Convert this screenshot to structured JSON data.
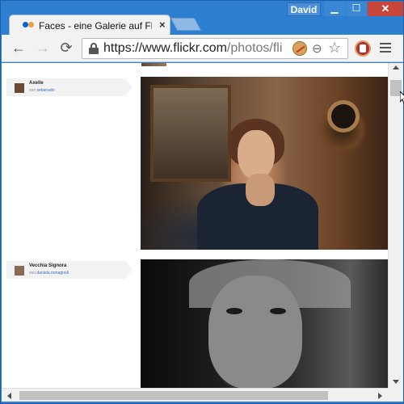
{
  "window": {
    "profile_name": "David",
    "min_glyph": "▁",
    "max_glyph": "☐",
    "close_glyph": "✕"
  },
  "tab": {
    "title": "Faces - eine Galerie auf Fli",
    "close_glyph": "×"
  },
  "toolbar": {
    "back_glyph": "←",
    "forward_glyph": "→",
    "reload_glyph": "⟳",
    "url_host": "https://www.flickr.com",
    "url_path": "/photos/fli",
    "zoom_glyph": "⊖",
    "star_glyph": "☆"
  },
  "gallery": {
    "items": [
      {
        "title": "Axelle",
        "by_prefix": "von",
        "author": "sebanado"
      },
      {
        "title": "Vecchia Signora",
        "by_prefix": "von",
        "author": "daniela romagnoli"
      }
    ]
  },
  "icons": {
    "favicon": "flickr-favicon",
    "lock": "lock-icon",
    "cookie": "cookie-blocked-icon",
    "extension": "extension-icon",
    "menu": "hamburger-menu-icon"
  },
  "colors": {
    "titlebar": "#2f7fd0",
    "close": "#c9453a",
    "link": "#2d6fc3",
    "flickr_blue": "#0063dc",
    "flickr_accent": "#e6a43f"
  }
}
